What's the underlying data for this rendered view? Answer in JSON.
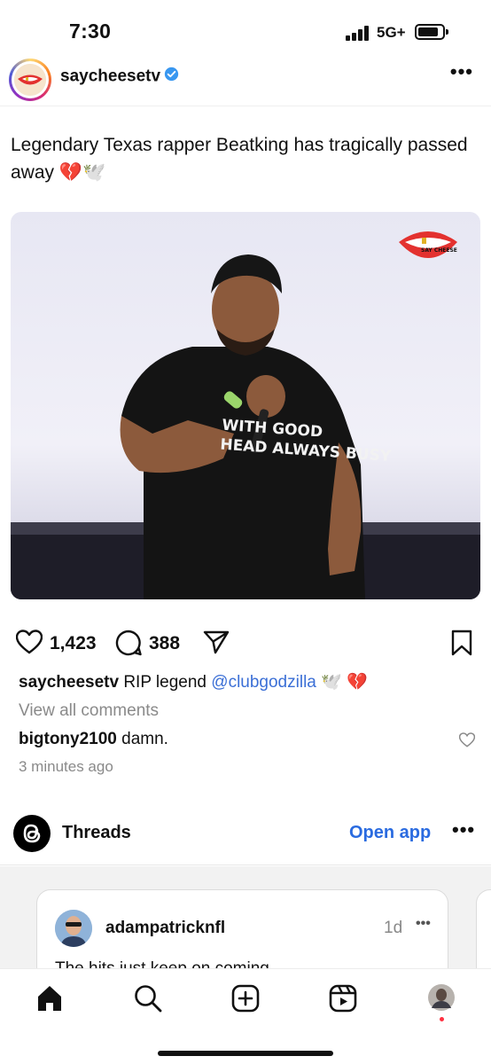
{
  "status_bar": {
    "time": "7:30",
    "network": "5G+",
    "icons": [
      "signal-bars-icon",
      "battery-icon"
    ]
  },
  "post": {
    "username": "saycheesetv",
    "verified": true,
    "caption": "Legendary Texas rapper Beatking has tragically passed away 💔🕊️",
    "image": {
      "shirt_text_line1": "WITH GOOD",
      "shirt_text_line2": "HEAD ALWAYS BUSY",
      "watermark": "SAY CHEESE"
    },
    "likes": "1,423",
    "comments": "388",
    "caption_user": "saycheesetv",
    "caption_text": " RIP legend ",
    "caption_mention": "@clubgodzilla",
    "caption_emoji": " 🕊️ 💔",
    "view_all_comments": "View all comments",
    "top_comment_user": "bigtony2100",
    "top_comment_text": " damn.",
    "time_ago": "3 minutes ago"
  },
  "threads": {
    "label": "Threads",
    "open_app": "Open app",
    "card": {
      "username": "adampatricknfl",
      "time": "1d",
      "text": "The hits just keep on coming"
    }
  },
  "nav": {
    "items": [
      "home-icon",
      "search-icon",
      "create-icon",
      "reels-icon",
      "profile-avatar"
    ]
  },
  "colors": {
    "link": "#3b6fd6",
    "open_app": "#2a6be0",
    "notification_dot": "#ff3040",
    "secondary_text": "#8a8a8a"
  }
}
